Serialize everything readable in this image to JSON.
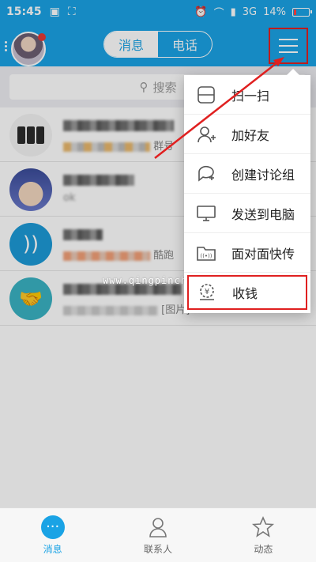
{
  "statusbar": {
    "time": "15:45",
    "network": "3G",
    "battery": "14%"
  },
  "header": {
    "tabs": [
      "消息",
      "电话"
    ],
    "active_tab": 0,
    "avatar_badge": true
  },
  "search": {
    "placeholder": "搜索"
  },
  "conversations": [
    {
      "name": "电脑手机交流群",
      "msg_suffix": "群号"
    },
    {
      "name": "吾泰闪翼梅",
      "msg_suffix": "ok"
    },
    {
      "name": "订阅号",
      "msg_suffix": "酷跑"
    },
    {
      "name": "武汉新博物馆交流",
      "msg_suffix": "[图片]"
    }
  ],
  "dropdown": {
    "items": [
      {
        "label": "扫一扫",
        "icon": "scan-icon"
      },
      {
        "label": "加好友",
        "icon": "add-friend-icon"
      },
      {
        "label": "创建讨论组",
        "icon": "discussion-icon"
      },
      {
        "label": "发送到电脑",
        "icon": "monitor-icon"
      },
      {
        "label": "面对面快传",
        "icon": "folder-transfer-icon"
      },
      {
        "label": "收钱",
        "icon": "receive-money-icon"
      }
    ],
    "highlighted_index": 5
  },
  "watermark": "www.qingpinchao.c",
  "tabbar": {
    "items": [
      {
        "label": "消息",
        "icon": "message-icon"
      },
      {
        "label": "联系人",
        "icon": "contacts-icon"
      },
      {
        "label": "动态",
        "icon": "star-icon"
      }
    ],
    "active": 0
  },
  "colors": {
    "brand_blue": "#1aa3e5",
    "highlight_red": "#e02020"
  }
}
